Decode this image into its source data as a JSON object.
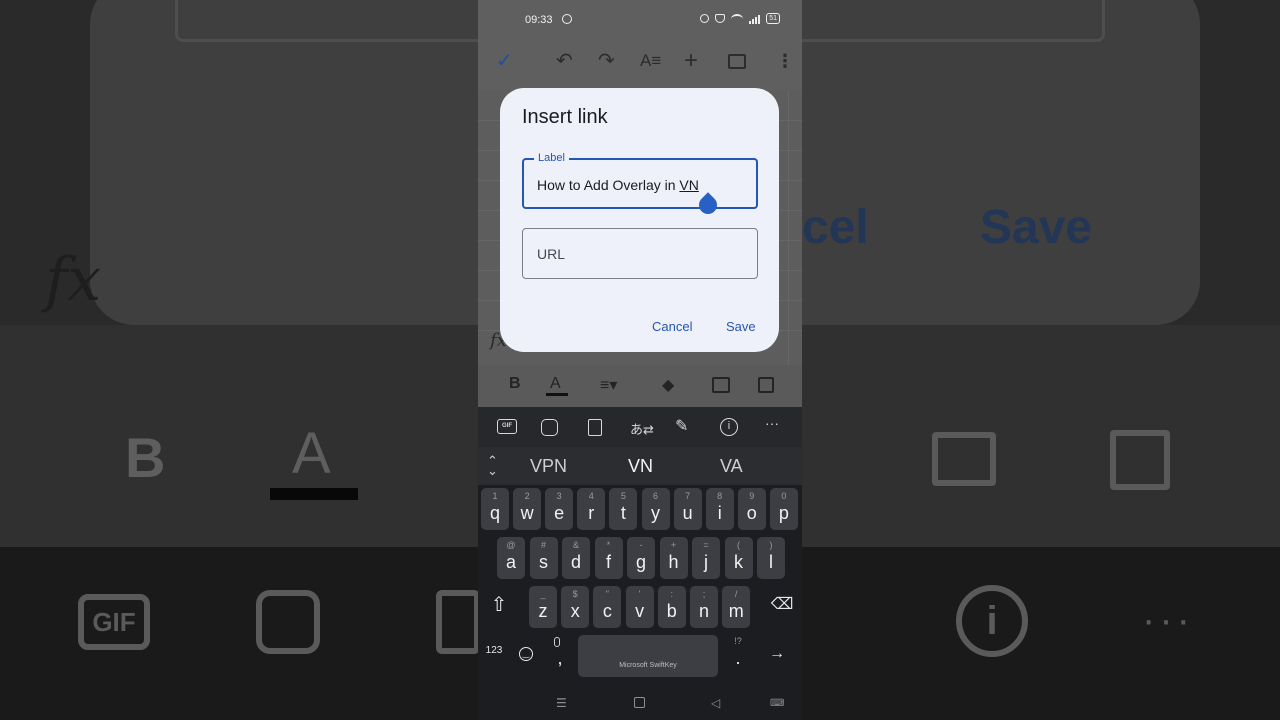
{
  "status_bar": {
    "time": "09:33",
    "battery": "51"
  },
  "background": {
    "cancel_fragment": "cel",
    "save_fragment": "Save",
    "bold_glyph": "B",
    "text_color_glyph": "A",
    "gif_glyph": "GIF",
    "info_glyph": "i",
    "more_glyph": "···"
  },
  "sheet": {
    "fx": "fx"
  },
  "format_bar": {
    "bold": "B",
    "text_color": "A"
  },
  "dialog": {
    "title": "Insert link",
    "label_field": {
      "legend": "Label",
      "value_prefix": "How to Add Overlay in ",
      "value_underlined": "VN"
    },
    "url_field": {
      "placeholder": "URL"
    },
    "cancel": "Cancel",
    "save": "Save"
  },
  "keyboard": {
    "toolbar": {
      "gif": "GIF",
      "info": "i",
      "more": "···"
    },
    "suggestions": [
      "VPN",
      "VN",
      "VA"
    ],
    "rows": [
      [
        {
          "main": "q",
          "sub": "1"
        },
        {
          "main": "w",
          "sub": "2"
        },
        {
          "main": "e",
          "sub": "3"
        },
        {
          "main": "r",
          "sub": "4"
        },
        {
          "main": "t",
          "sub": "5"
        },
        {
          "main": "y",
          "sub": "6"
        },
        {
          "main": "u",
          "sub": "7"
        },
        {
          "main": "i",
          "sub": "8"
        },
        {
          "main": "o",
          "sub": "9"
        },
        {
          "main": "p",
          "sub": "0"
        }
      ],
      [
        {
          "main": "a",
          "sub": "@"
        },
        {
          "main": "s",
          "sub": "#"
        },
        {
          "main": "d",
          "sub": "&"
        },
        {
          "main": "f",
          "sub": "*"
        },
        {
          "main": "g",
          "sub": "-"
        },
        {
          "main": "h",
          "sub": "+"
        },
        {
          "main": "j",
          "sub": "="
        },
        {
          "main": "k",
          "sub": "("
        },
        {
          "main": "l",
          "sub": ")"
        }
      ],
      [
        {
          "main": "z",
          "sub": "_"
        },
        {
          "main": "x",
          "sub": "$"
        },
        {
          "main": "c",
          "sub": "\""
        },
        {
          "main": "v",
          "sub": "'"
        },
        {
          "main": "b",
          "sub": ":"
        },
        {
          "main": "n",
          "sub": ";"
        },
        {
          "main": "m",
          "sub": "/"
        }
      ]
    ],
    "key_123": "123",
    "key_comma": ",",
    "key_period": ".",
    "period_sub": "!?",
    "space_label": "Microsoft SwiftKey",
    "enter": "→"
  },
  "icons": {
    "confirm": "check-icon",
    "undo": "undo-icon",
    "redo": "redo-icon",
    "text_format": "text-format-icon",
    "insert": "plus-icon",
    "comment": "comment-icon",
    "more": "more-vertical-icon"
  }
}
